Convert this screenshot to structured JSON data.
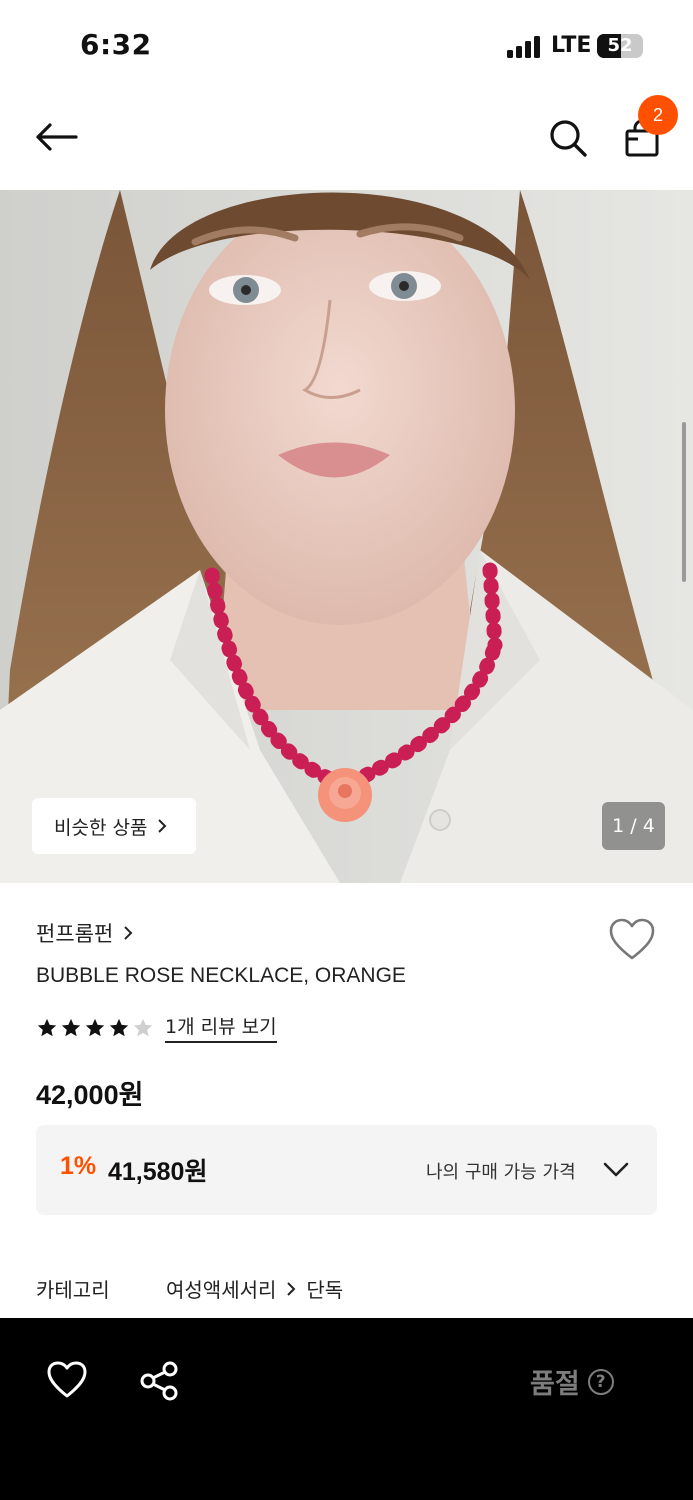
{
  "status_bar": {
    "time": "6:32",
    "network": "LTE",
    "battery": "52",
    "battery_level": 0.52
  },
  "header": {
    "cart_count": "2",
    "icons": [
      "back-arrow-icon",
      "search-icon",
      "shopping-bag-icon"
    ]
  },
  "gallery": {
    "similar_button": "비슷한 상품",
    "page_indicator": "1 / 4",
    "image_description_icon": "product-photo"
  },
  "product": {
    "brand": "펀프롬펀",
    "name": "BUBBLE ROSE NECKLACE, ORANGE",
    "rating": 4,
    "rating_max": 5,
    "review_link": "1개 리뷰 보기",
    "price": "42,000원",
    "discount_rate": "1%",
    "discount_price": "41,580원",
    "my_price_label": "나의 구매 가능 가격",
    "category_label": "카테고리",
    "category_path": [
      "여성액세서리",
      "단독"
    ]
  },
  "bottom_bar": {
    "soldout_label": "품절",
    "help_glyph": "?"
  },
  "colors": {
    "accent": "#ff5000",
    "bottom_bar": "#000000",
    "soldout_text": "#7d7d7d",
    "discount_box": "#f4f4f4"
  }
}
